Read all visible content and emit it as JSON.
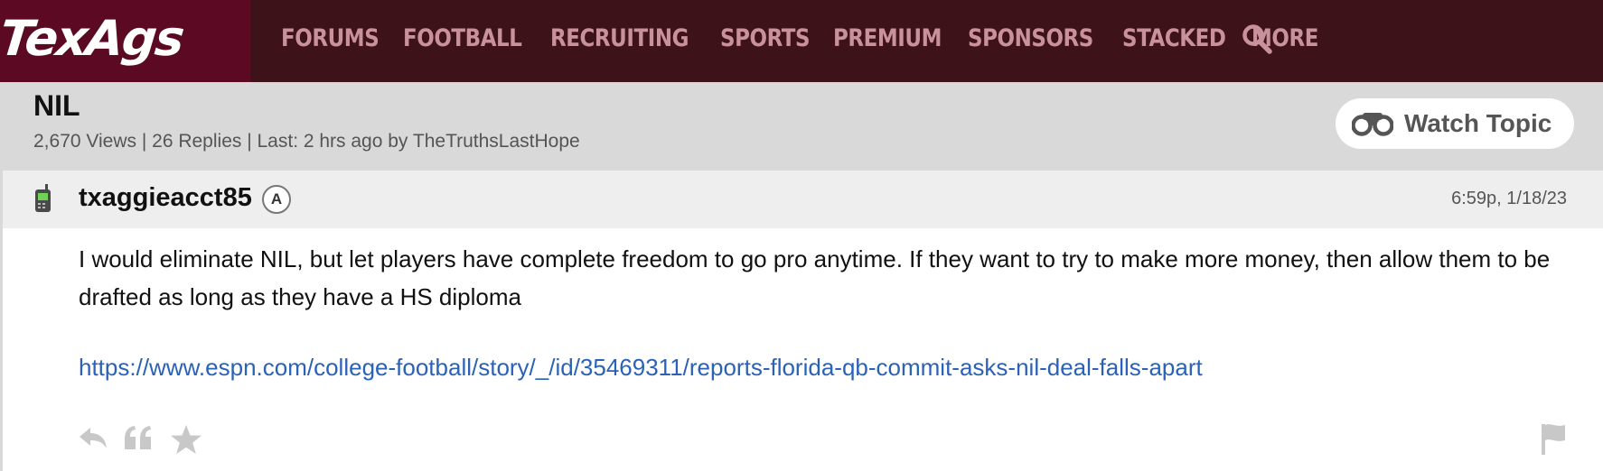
{
  "nav": {
    "logo": "TexAgs",
    "items": [
      "FORUMS",
      "FOOTBALL",
      "RECRUITING",
      "SPORTS",
      "PREMIUM",
      "SPONSORS",
      "STACKED",
      "MORE"
    ],
    "search_icon": "search-icon"
  },
  "topic": {
    "title": "NIL",
    "meta": "2,670 Views | 26 Replies | Last: 2 hrs ago by TheTruthsLastHope",
    "watch_label": "Watch Topic",
    "watch_icon": "binoculars-icon"
  },
  "post": {
    "device_icon": "phone-icon",
    "username": "txaggieacct85",
    "badge": "A",
    "timestamp": "6:59p, 1/18/23",
    "body": "I would eliminate NIL, but let players have complete freedom to go pro anytime. If they want to try to make more money, then allow them to be drafted as long as they have a HS diploma",
    "link": "https://www.espn.com/college-football/story/_/id/35469311/reports-florida-qb-commit-asks-nil-deal-falls-apart",
    "actions": [
      "reply-icon",
      "quote-icon",
      "star-icon",
      "flag-icon"
    ]
  },
  "colors": {
    "nav_bg": "#3d1219",
    "logo_bg": "#5c0a24",
    "nav_text": "#c9919b",
    "header_bg": "#d9d9d9",
    "link": "#2a62b8"
  }
}
